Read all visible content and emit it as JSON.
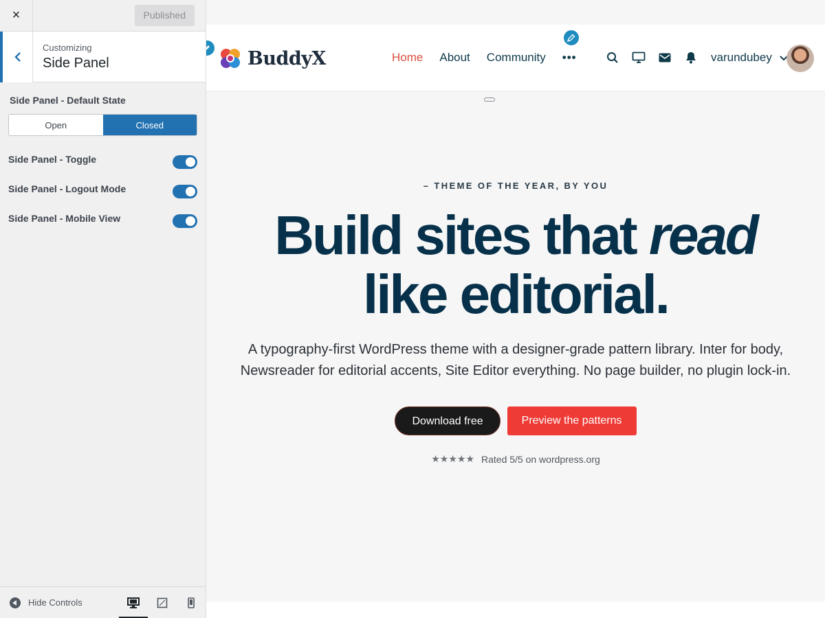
{
  "customizer": {
    "close_label": "×",
    "published_label": "Published",
    "header": {
      "sub": "Customizing",
      "title": "Side Panel"
    },
    "default_state": {
      "heading": "Side Panel - Default State",
      "options": [
        "Open",
        "Closed"
      ],
      "selected": "Closed"
    },
    "toggles": [
      {
        "label": "Side Panel - Toggle",
        "on": true
      },
      {
        "label": "Side Panel - Logout Mode",
        "on": true
      },
      {
        "label": "Side Panel - Mobile View",
        "on": true
      }
    ],
    "footer": {
      "hide_controls": "Hide Controls",
      "devices": [
        "desktop-icon",
        "tablet-icon",
        "mobile-icon"
      ],
      "active_device": "desktop"
    },
    "accent": "#2271b1"
  },
  "site": {
    "logo_text": "BuddyX",
    "nav": [
      {
        "label": "Home",
        "current": true
      },
      {
        "label": "About",
        "current": false
      },
      {
        "label": "Community",
        "current": false
      }
    ],
    "nav_more": "•••",
    "header_icons": [
      "search-icon",
      "monitor-icon",
      "mail-icon",
      "bell-icon"
    ],
    "user": "varundubey",
    "hero": {
      "eyebrow": "– THEME OF THE YEAR, BY YOU",
      "headline_part1": "Build sites that ",
      "headline_em": "read",
      "headline_part2": "like editorial.",
      "lead": "A typography-first WordPress theme with a designer-grade pattern library. Inter for body, Newsreader for editorial accents, Site Editor everything. No page builder, no plugin lock-in.",
      "cta_primary": "Download free",
      "cta_secondary": "Preview the patterns",
      "stars": "★★★★★",
      "rating_text": "Rated 5/5 on wordpress.org"
    },
    "colors": {
      "accent_red": "#ee3b36",
      "headline": "#07314a",
      "nav_current": "#d94f3d"
    }
  }
}
